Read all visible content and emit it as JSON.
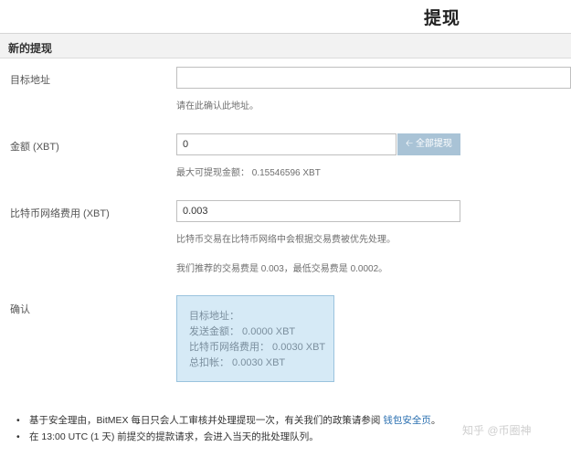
{
  "header": {
    "title": "提现"
  },
  "section": {
    "title": "新的提现"
  },
  "form": {
    "address": {
      "label": "目标地址",
      "value": "",
      "hint": "请在此确认此地址。"
    },
    "amount": {
      "label": "金额 (XBT)",
      "value": "0",
      "all_button": "全部提现",
      "all_icon": "arrow-left-icon",
      "hint": "最大可提现金额： 0.15546596 XBT"
    },
    "fee": {
      "label": "比特币网络费用 (XBT)",
      "value": "0.003",
      "hint1": "比特币交易在比特币网络中会根据交易费被优先处理。",
      "hint2": "我们推荐的交易费是 0.003，最低交易费是 0.0002。"
    },
    "confirm": {
      "label": "确认",
      "lines": [
        "目标地址：",
        "发送金额： 0.0000 XBT",
        "比特币网络费用： 0.0030 XBT",
        "总扣帐： 0.0030 XBT"
      ]
    }
  },
  "notes": [
    {
      "text": "基于安全理由，BitMEX 每日只会人工审核并处理提现一次，有关我们的政策请参阅",
      "link": "钱包安全页",
      "suffix": "。"
    },
    {
      "text": "在 13:00 UTC (1 天) 前提交的提款请求，会进入当天的批处理队列。"
    }
  ],
  "watermark": "知乎 @币圈神"
}
